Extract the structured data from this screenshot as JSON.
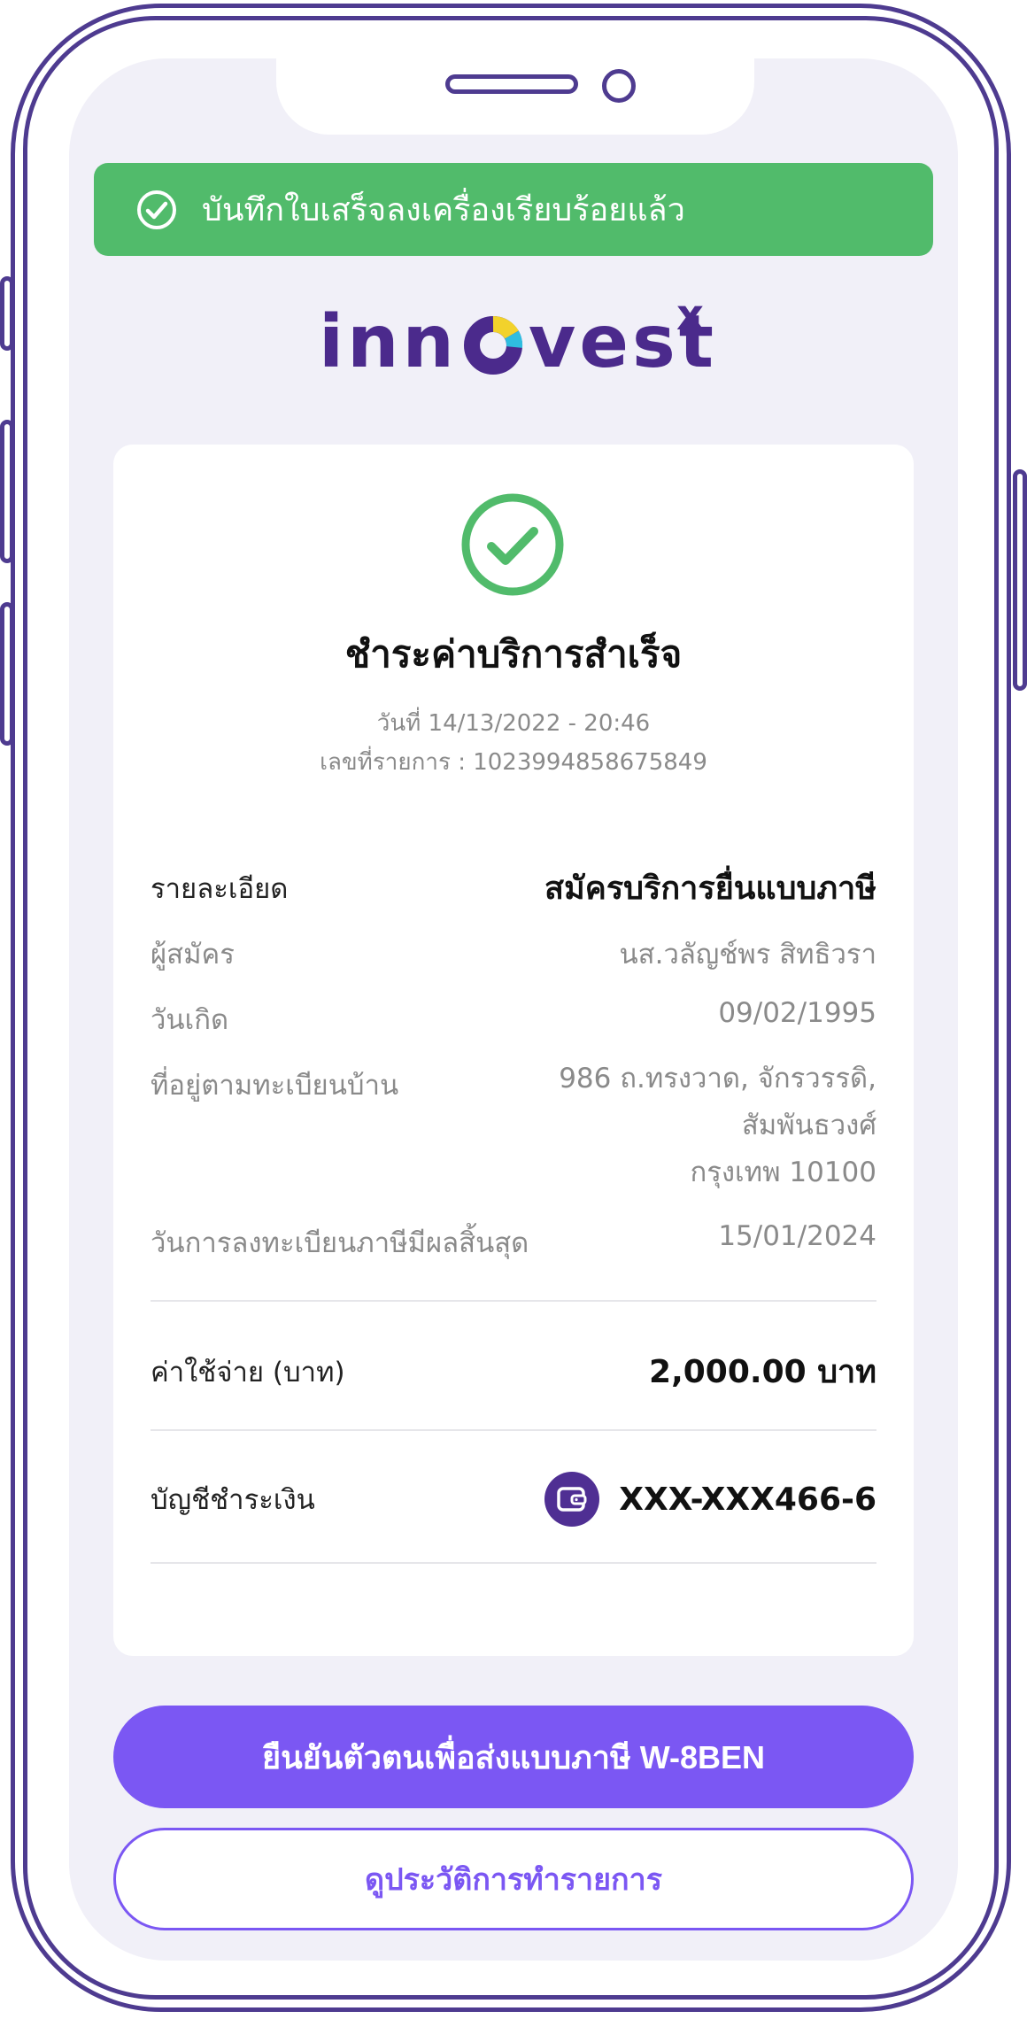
{
  "toast": {
    "message": "บันทึกใบเสร็จลงเครื่องเรียบร้อยแล้ว"
  },
  "logo": {
    "left": "inn",
    "right": "vest",
    "suffix": "x"
  },
  "receipt": {
    "title": "ชำระค่าบริการสำเร็จ",
    "date_line": "วันที่ 14/13/2022 - 20:46",
    "ref_line": "เลขที่รายการ : 1023994858675849",
    "details_label": "รายละเอียด",
    "details_value": "สมัครบริการยื่นแบบภาษี",
    "applicant_label": "ผู้สมัคร",
    "applicant_value": "นส.วลัญช์พร สิทธิวรา",
    "birth_label": "วันเกิด",
    "birth_value": "09/02/1995",
    "address_label": "ที่อยู่ตามทะเบียนบ้าน",
    "address_lines": [
      "986 ถ.ทรงวาด, จักรวรรดิ,",
      "สัมพันธวงศ์",
      "กรุงเทพ 10100"
    ],
    "expiry_label": "วันการลงทะเบียนภาษีมีผลสิ้นสุด",
    "expiry_value": "15/01/2024",
    "cost_label": "ค่าใช้จ่าย (บาท)",
    "cost_value": "2,000.00 บาท",
    "account_label": "บัญชีชำระเงิน",
    "account_value": "XXX-XXX466-6"
  },
  "buttons": {
    "primary": "ยืนยันตัวตนเพื่อส่งแบบภาษี W-8BEN",
    "secondary": "ดูประวัติการทำรายการ"
  },
  "colors": {
    "success": "#51bb6b",
    "brand": "#4b2a8c",
    "accent": "#7b57f3"
  }
}
